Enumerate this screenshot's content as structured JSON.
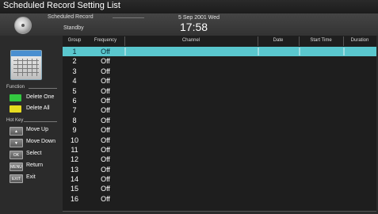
{
  "window": {
    "title": "Scheduled Record Setting List"
  },
  "info_bar": {
    "scheduled_record_label": "Scheduled Record",
    "status": "Standby",
    "date": "5 Sep 2001 Wed",
    "time": "17:58"
  },
  "sidebar": {
    "function_label": "Function",
    "function_items": [
      {
        "key_color": "#33c840",
        "label": "Delete One"
      },
      {
        "key_color": "#e6dc20",
        "label": "Delete All"
      }
    ],
    "hotkey_label": "Hot Key",
    "hotkeys": [
      {
        "key": "▲",
        "label": "Move Up"
      },
      {
        "key": "▼",
        "label": "Move Down"
      },
      {
        "key": "OK",
        "label": "Select"
      },
      {
        "key": "MENU",
        "label": "Return"
      },
      {
        "key": "EXIT",
        "label": "Exit"
      }
    ]
  },
  "table": {
    "columns": [
      "Group",
      "Frequency",
      "Channel",
      "Date",
      "Start Time",
      "Duration"
    ],
    "selected_row": 0,
    "rows": [
      {
        "group": "1",
        "frequency": "Off"
      },
      {
        "group": "2",
        "frequency": "Off"
      },
      {
        "group": "3",
        "frequency": "Off"
      },
      {
        "group": "4",
        "frequency": "Off"
      },
      {
        "group": "5",
        "frequency": "Off"
      },
      {
        "group": "6",
        "frequency": "Off"
      },
      {
        "group": "7",
        "frequency": "Off"
      },
      {
        "group": "8",
        "frequency": "Off"
      },
      {
        "group": "9",
        "frequency": "Off"
      },
      {
        "group": "10",
        "frequency": "Off"
      },
      {
        "group": "11",
        "frequency": "Off"
      },
      {
        "group": "12",
        "frequency": "Off"
      },
      {
        "group": "13",
        "frequency": "Off"
      },
      {
        "group": "14",
        "frequency": "Off"
      },
      {
        "group": "15",
        "frequency": "Off"
      },
      {
        "group": "16",
        "frequency": "Off"
      }
    ]
  },
  "colors": {
    "highlight": "#5ac7ce",
    "background": "#2b2b2b"
  }
}
